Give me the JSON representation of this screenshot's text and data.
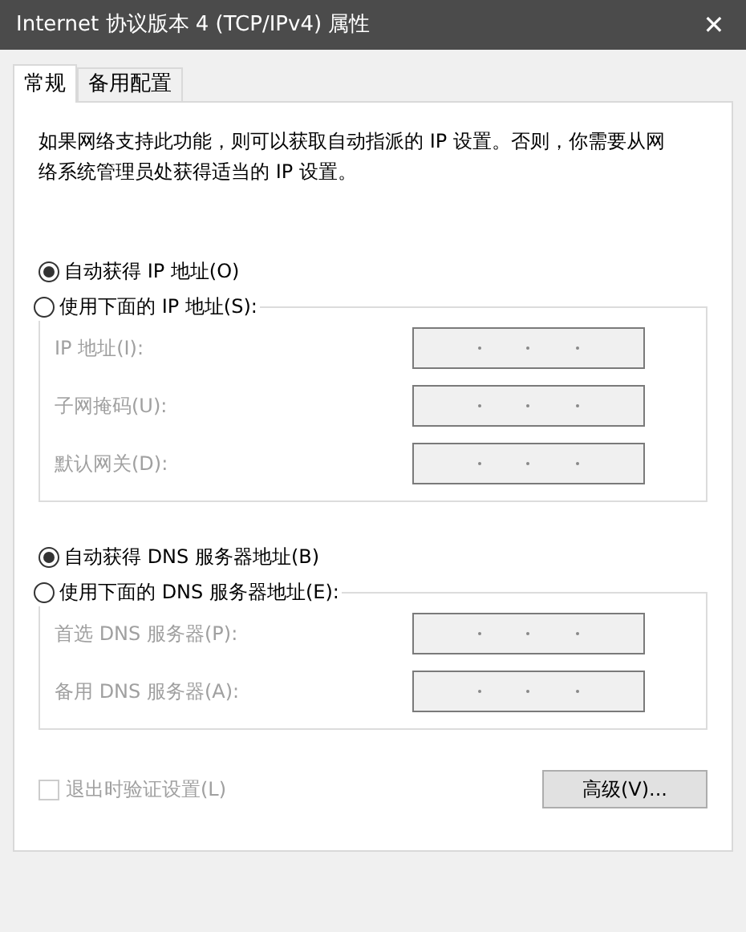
{
  "window": {
    "title": "Internet 协议版本 4 (TCP/IPv4) 属性",
    "close": "✕"
  },
  "tabs": [
    {
      "label": "常规",
      "selected": true
    },
    {
      "label": "备用配置",
      "selected": false
    }
  ],
  "description": "如果网络支持此功能，则可以获取自动指派的 IP 设置。否则，你需要从网络系统管理员处获得适当的 IP 设置。",
  "sections": [
    {
      "auto_option": {
        "label": "自动获得 IP 地址(O)",
        "selected": true
      },
      "manual_option": {
        "label": "使用下面的 IP 地址(S):",
        "selected": false
      },
      "fields": [
        {
          "label": "IP 地址(I):",
          "disabled": true
        },
        {
          "label": "子网掩码(U):",
          "disabled": true
        },
        {
          "label": "默认网关(D):",
          "disabled": true
        }
      ]
    },
    {
      "auto_option": {
        "label": "自动获得 DNS 服务器地址(B)",
        "selected": true
      },
      "manual_option": {
        "label": "使用下面的 DNS 服务器地址(E):",
        "selected": false
      },
      "fields": [
        {
          "label": "首选 DNS 服务器(P):",
          "disabled": true
        },
        {
          "label": "备用 DNS 服务器(A):",
          "disabled": true
        }
      ]
    }
  ],
  "validate_checkbox": {
    "label": "退出时验证设置(L)",
    "checked": false,
    "disabled": true
  },
  "advanced_button": "高级(V)..."
}
